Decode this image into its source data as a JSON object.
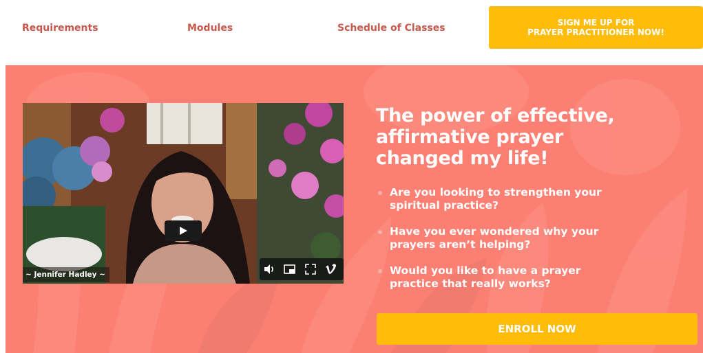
{
  "nav": {
    "links": [
      "Requirements",
      "Modules",
      "Schedule of Classes"
    ],
    "signup_line1": "SIGN ME UP FOR",
    "signup_line2": "PRAYER PRACTITIONER NOW!"
  },
  "video": {
    "caption": "~ Jennifer Hadley ~",
    "icons": [
      "play-icon",
      "volume-icon",
      "picture-in-picture-icon",
      "fullscreen-icon",
      "vimeo-logo-icon"
    ]
  },
  "hero": {
    "headline": [
      "The power of effective,",
      "affirmative prayer",
      "changed my life!"
    ],
    "bullets": [
      [
        "Are you looking to strengthen your",
        "spiritual practice?"
      ],
      [
        "Have you ever wondered why your",
        "prayers aren’t helping?"
      ],
      [
        "Would you like to have a prayer",
        "practice that really works?"
      ]
    ],
    "enroll_label": "ENROLL NOW"
  },
  "colors": {
    "nav_link": "#c9584c",
    "accent_button": "#ffbc0a",
    "hero_background": "#fb8073",
    "text_on_hero": "#ffffff"
  }
}
